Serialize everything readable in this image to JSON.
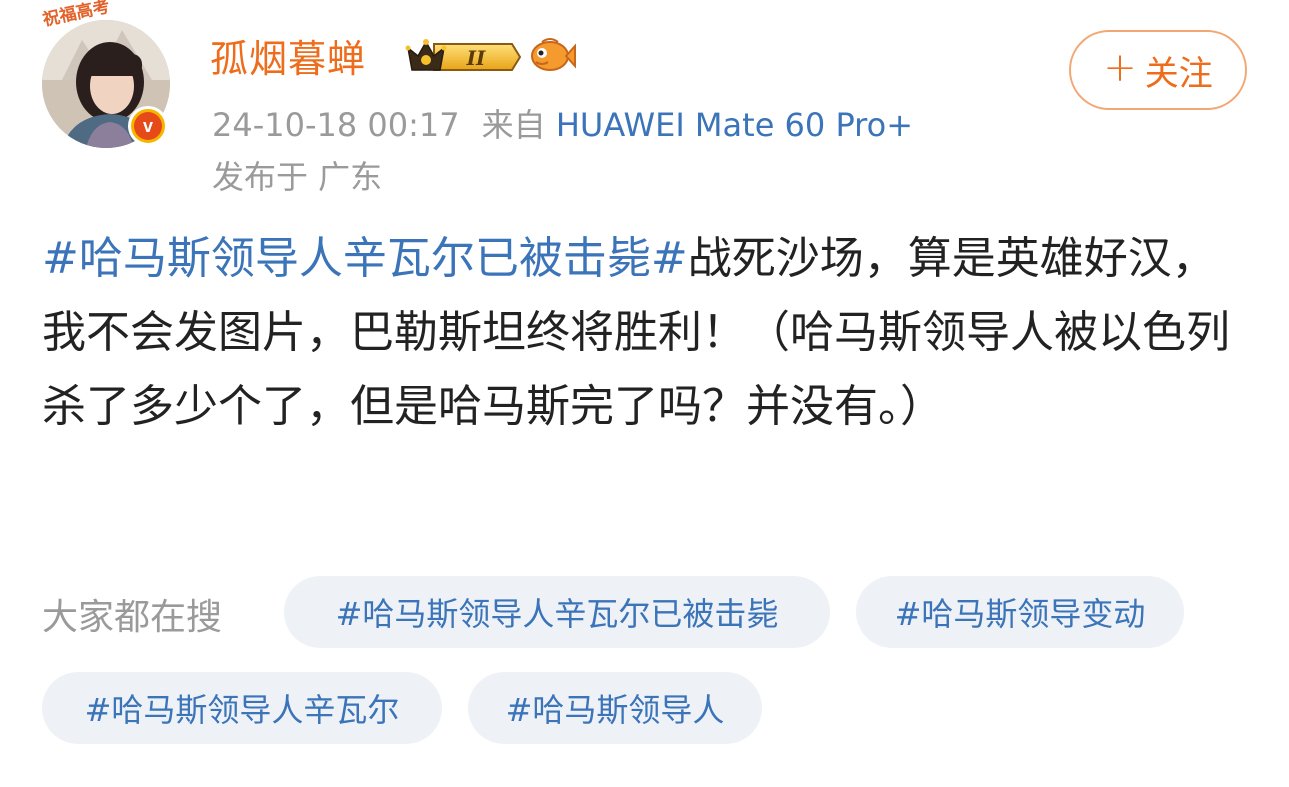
{
  "profile": {
    "avatar_frame_text": "祝福高考",
    "verified_mark": "v",
    "username": "孤烟暮蝉",
    "vip_level": "II"
  },
  "follow_button": {
    "plus": "+",
    "label": "关注"
  },
  "meta": {
    "timestamp": "24-10-18 00:17",
    "source_prefix": "来自",
    "device": "HUAWEI Mate 60 Pro+",
    "location": "发布于 广东"
  },
  "post": {
    "topic": "#哈马斯领导人辛瓦尔已被击毙#",
    "text_line1": "战死沙场，算是",
    "text_rest": "英雄好汉，我不会发图片，巴勒斯坦终将胜利！（哈马斯领导人被以色列杀了多少个了，但是哈马斯完了吗？并没有。）"
  },
  "search": {
    "label": "大家都在搜",
    "tags": [
      "#哈马斯领导人辛瓦尔已被击毙",
      "#哈马斯领导变动",
      "#哈马斯领导人辛瓦尔",
      "#哈马斯领导人"
    ]
  },
  "colors": {
    "accent_orange": "#ee6d1c",
    "link_blue": "#3b74b8",
    "meta_gray": "#9a9a9a",
    "tag_bg": "#eef2f7"
  }
}
